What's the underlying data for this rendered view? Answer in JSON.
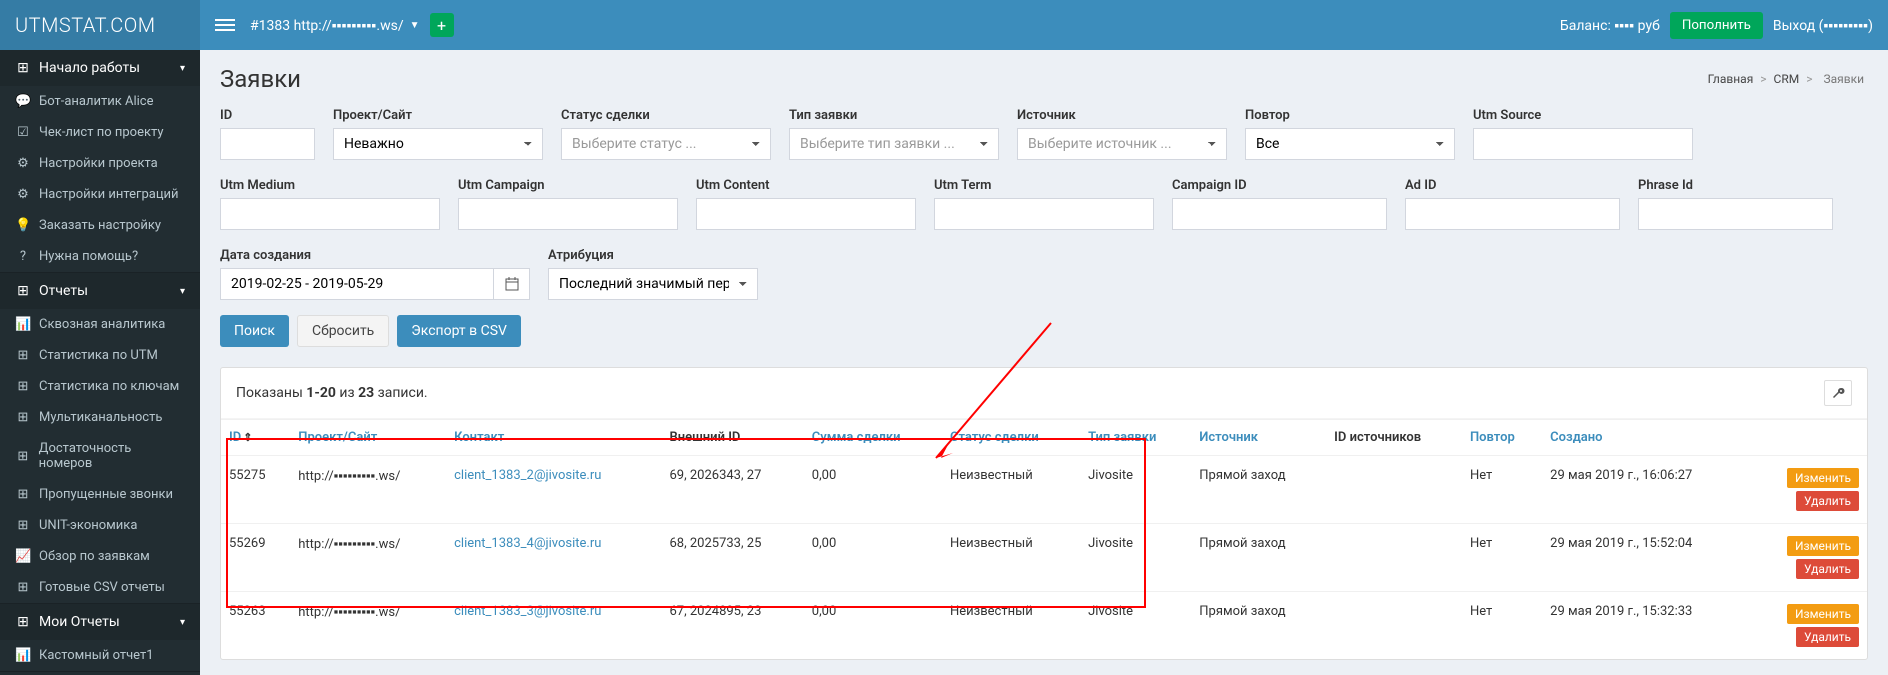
{
  "header": {
    "logo": "UTMSTAT.COM",
    "site": "#1383 http://▪▪▪▪▪▪▪▪▪.ws/",
    "plus": "+",
    "balance_label": "Баланс:",
    "balance_value": "▪▪▪▪ руб",
    "refill": "Пополнить",
    "logout": "Выход (▪▪▪▪▪▪▪▪▪)"
  },
  "sidebar": {
    "start": {
      "title": "Начало работы",
      "items": [
        {
          "icon": "💬",
          "label": "Бот-аналитик Alice"
        },
        {
          "icon": "☑",
          "label": "Чек-лист по проекту"
        },
        {
          "icon": "⚙",
          "label": "Настройки проекта"
        },
        {
          "icon": "⚙",
          "label": "Настройки интеграций"
        },
        {
          "icon": "💡",
          "label": "Заказать настройку"
        },
        {
          "icon": "?",
          "label": "Нужна помощь?"
        }
      ]
    },
    "reports": {
      "title": "Отчеты",
      "items": [
        {
          "icon": "📊",
          "label": "Сквозная аналитика"
        },
        {
          "icon": "⊞",
          "label": "Статистика по UTM"
        },
        {
          "icon": "⊞",
          "label": "Статистика по ключам"
        },
        {
          "icon": "⊞",
          "label": "Мультиканальность"
        },
        {
          "icon": "⊞",
          "label": "Достаточность номеров"
        },
        {
          "icon": "⊞",
          "label": "Пропущенные звонки"
        },
        {
          "icon": "⊞",
          "label": "UNIT-экономика"
        },
        {
          "icon": "📈",
          "label": "Обзор по заявкам"
        },
        {
          "icon": "⊞",
          "label": "Готовые CSV отчеты"
        }
      ]
    },
    "myreports": {
      "title": "Мои Отчеты",
      "items": [
        {
          "icon": "📊",
          "label": "Кастомный отчет1"
        }
      ]
    }
  },
  "content": {
    "title": "Заявки",
    "breadcrumb": {
      "main": "Главная",
      "crm": "CRM",
      "active": "Заявки"
    }
  },
  "filters": {
    "id": {
      "label": "ID"
    },
    "project": {
      "label": "Проект/Сайт",
      "value": "Неважно"
    },
    "status": {
      "label": "Статус сделки",
      "placeholder": "Выберите статус ..."
    },
    "type": {
      "label": "Тип заявки",
      "placeholder": "Выберите тип заявки ..."
    },
    "source": {
      "label": "Источник",
      "placeholder": "Выберите источник ..."
    },
    "repeat": {
      "label": "Повтор",
      "value": "Все"
    },
    "utm_source": {
      "label": "Utm Source"
    },
    "utm_medium": {
      "label": "Utm Medium"
    },
    "utm_campaign": {
      "label": "Utm Campaign"
    },
    "utm_content": {
      "label": "Utm Content"
    },
    "utm_term": {
      "label": "Utm Term"
    },
    "campaign_id": {
      "label": "Campaign ID"
    },
    "ad_id": {
      "label": "Ad ID"
    },
    "phrase_id": {
      "label": "Phrase Id"
    },
    "date": {
      "label": "Дата создания",
      "value": "2019-02-25 - 2019-05-29"
    },
    "attribution": {
      "label": "Атрибуция",
      "value": "Последний значимый переход"
    }
  },
  "buttons": {
    "search": "Поиск",
    "reset": "Сбросить",
    "export": "Экспорт в CSV"
  },
  "panel": {
    "shown_prefix": "Показаны ",
    "shown_range": "1-20",
    "shown_mid": " из ",
    "shown_total": "23",
    "shown_suffix": " записи."
  },
  "table": {
    "headers": {
      "id": "ID",
      "project": "Проект/Сайт",
      "contact": "Контакт",
      "external_id": "Внешний ID",
      "amount": "Сумма сделки",
      "status": "Статус сделки",
      "type": "Тип заявки",
      "source": "Источник",
      "source_ids": "ID источников",
      "repeat": "Повтор",
      "created": "Создано"
    },
    "actions": {
      "edit": "Изменить",
      "delete": "Удалить"
    },
    "rows": [
      {
        "id": "55275",
        "project": "http://▪▪▪▪▪▪▪▪▪.ws/",
        "contact": "client_1383_2@jivosite.ru",
        "external": "69, 2026343, 27",
        "amount": "0,00",
        "status": "Неизвестный",
        "type": "Jivosite",
        "source": "Прямой заход",
        "source_ids": "",
        "repeat": "Нет",
        "created": "29 мая 2019 г., 16:06:27"
      },
      {
        "id": "55269",
        "project": "http://▪▪▪▪▪▪▪▪▪.ws/",
        "contact": "client_1383_4@jivosite.ru",
        "external": "68, 2025733, 25",
        "amount": "0,00",
        "status": "Неизвестный",
        "type": "Jivosite",
        "source": "Прямой заход",
        "source_ids": "",
        "repeat": "Нет",
        "created": "29 мая 2019 г., 15:52:04"
      },
      {
        "id": "55263",
        "project": "http://▪▪▪▪▪▪▪▪▪.ws/",
        "contact": "client_1383_3@jivosite.ru",
        "external": "67, 2024895, 23",
        "amount": "0,00",
        "status": "Неизвестный",
        "type": "Jivosite",
        "source": "Прямой заход",
        "source_ids": "",
        "repeat": "Нет",
        "created": "29 мая 2019 г., 15:32:33"
      }
    ]
  }
}
